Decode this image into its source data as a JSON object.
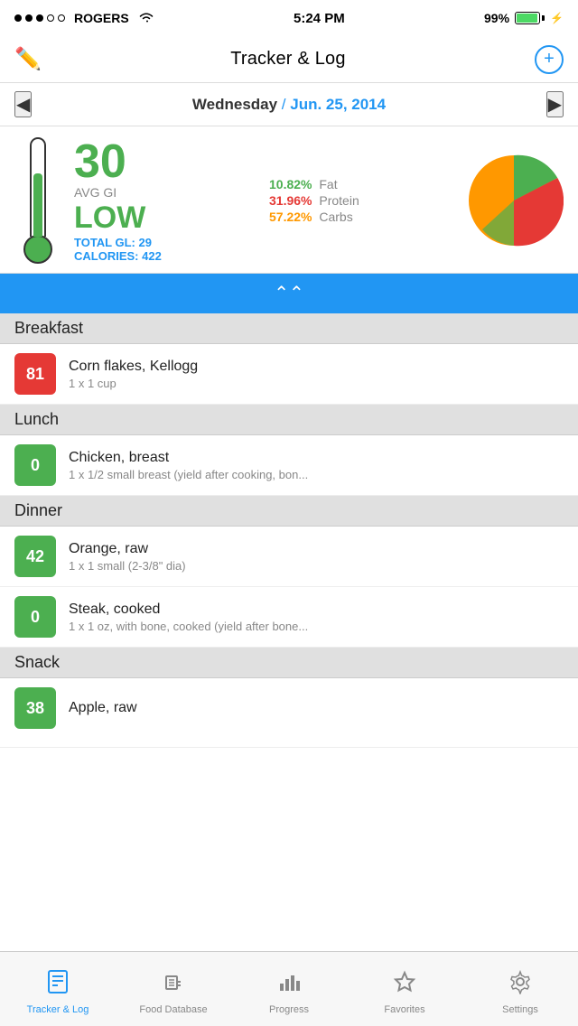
{
  "statusBar": {
    "carrier": "ROGERS",
    "time": "5:24 PM",
    "battery": "99%"
  },
  "navBar": {
    "title": "Tracker & Log",
    "editIcon": "✏",
    "addIcon": "+"
  },
  "dateBar": {
    "day": "Wednesday",
    "slash": " / ",
    "date": "Jun. 25, 2014",
    "prevArrow": "◀",
    "nextArrow": "▶"
  },
  "summary": {
    "avgGiLabel": "AVG GI",
    "avgGiValue": "30",
    "levelLabel": "LOW",
    "totalGlLabel": "TOTAL GL:",
    "totalGlValue": "29",
    "caloriesLabel": "CALORIES:",
    "caloriesValue": "422",
    "fatPct": "10.82%",
    "fatLabel": "Fat",
    "proteinPct": "31.96%",
    "proteinLabel": "Protein",
    "carbsPct": "57.22%",
    "carbsLabel": "Carbs"
  },
  "collapseBar": {
    "icon": "⌃⌃"
  },
  "meals": [
    {
      "name": "Breakfast",
      "items": [
        {
          "gi": "81",
          "giColor": "red",
          "foodName": "Corn flakes, Kellogg",
          "serving": "1 x 1 cup"
        }
      ]
    },
    {
      "name": "Lunch",
      "items": [
        {
          "gi": "0",
          "giColor": "green",
          "foodName": "Chicken, breast",
          "serving": "1 x 1/2 small breast (yield after cooking, bon..."
        }
      ]
    },
    {
      "name": "Dinner",
      "items": [
        {
          "gi": "42",
          "giColor": "green",
          "foodName": "Orange, raw",
          "serving": "1 x 1 small (2-3/8\" dia)"
        },
        {
          "gi": "0",
          "giColor": "green",
          "foodName": "Steak, cooked",
          "serving": "1 x 1 oz, with bone, cooked (yield after bone..."
        }
      ]
    },
    {
      "name": "Snack",
      "items": [
        {
          "gi": "38",
          "giColor": "green",
          "foodName": "Apple, raw",
          "serving": ""
        }
      ]
    }
  ],
  "tabs": [
    {
      "id": "tracker",
      "label": "Tracker & Log",
      "icon": "📋",
      "active": true
    },
    {
      "id": "food-database",
      "label": "Food Database",
      "icon": "🥤",
      "active": false
    },
    {
      "id": "progress",
      "label": "Progress",
      "icon": "📊",
      "active": false
    },
    {
      "id": "favorites",
      "label": "Favorites",
      "icon": "⭐",
      "active": false
    },
    {
      "id": "settings",
      "label": "Settings",
      "icon": "⚙",
      "active": false
    }
  ],
  "colors": {
    "fat": "#4CAF50",
    "protein": "#e53935",
    "carbs": "#FF9800",
    "accent": "#2196F3"
  }
}
